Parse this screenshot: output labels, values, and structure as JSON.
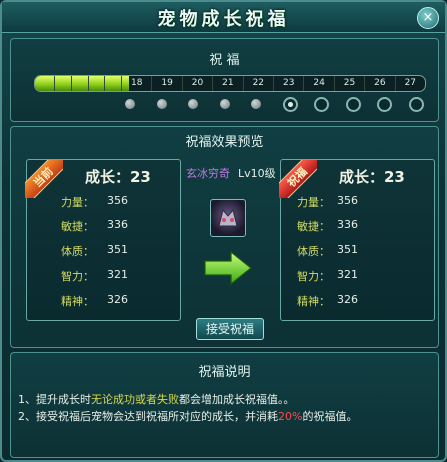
{
  "title": "宠物成长祝福",
  "close_label": "×",
  "blessing": {
    "title": "祝  福",
    "progress": 0.24,
    "ticks": [
      "18",
      "19",
      "20",
      "21",
      "22",
      "23",
      "24",
      "25",
      "26",
      "27"
    ],
    "dots": [
      "filled",
      "filled",
      "filled",
      "filled",
      "filled",
      "current",
      "empty",
      "empty",
      "empty",
      "empty"
    ]
  },
  "preview": {
    "title": "祝福效果预览",
    "pet_name": "玄冰穷奇",
    "pet_level": "Lv10级",
    "current": {
      "ribbon": "当前",
      "growth": "成长：23",
      "stats": [
        {
          "label": "力量：",
          "value": "356"
        },
        {
          "label": "敏捷：",
          "value": "336"
        },
        {
          "label": "体质：",
          "value": "351"
        },
        {
          "label": "智力：",
          "value": "321"
        },
        {
          "label": "精神：",
          "value": "326"
        }
      ]
    },
    "blessed": {
      "ribbon": "祝福",
      "growth": "成长：23",
      "stats": [
        {
          "label": "力量：",
          "value": "356"
        },
        {
          "label": "敏捷：",
          "value": "336"
        },
        {
          "label": "体质：",
          "value": "351"
        },
        {
          "label": "智力：",
          "value": "321"
        },
        {
          "label": "精神：",
          "value": "326"
        }
      ]
    },
    "accept_button": "接受祝福"
  },
  "description": {
    "title": "祝福说明",
    "line1_a": "1、提升成长时",
    "line1_b": "无论成功或者失败",
    "line1_c": "都会增加成长祝福值。。",
    "line2_a": "2、接受祝福后宠物会达到祝福所对应的成长，并消耗",
    "line2_b": "20%",
    "line2_c": "的祝福值。"
  },
  "colors": {
    "accent": "#d3dc62",
    "progress": "#a6e024",
    "warn": "#ff4a4a"
  }
}
